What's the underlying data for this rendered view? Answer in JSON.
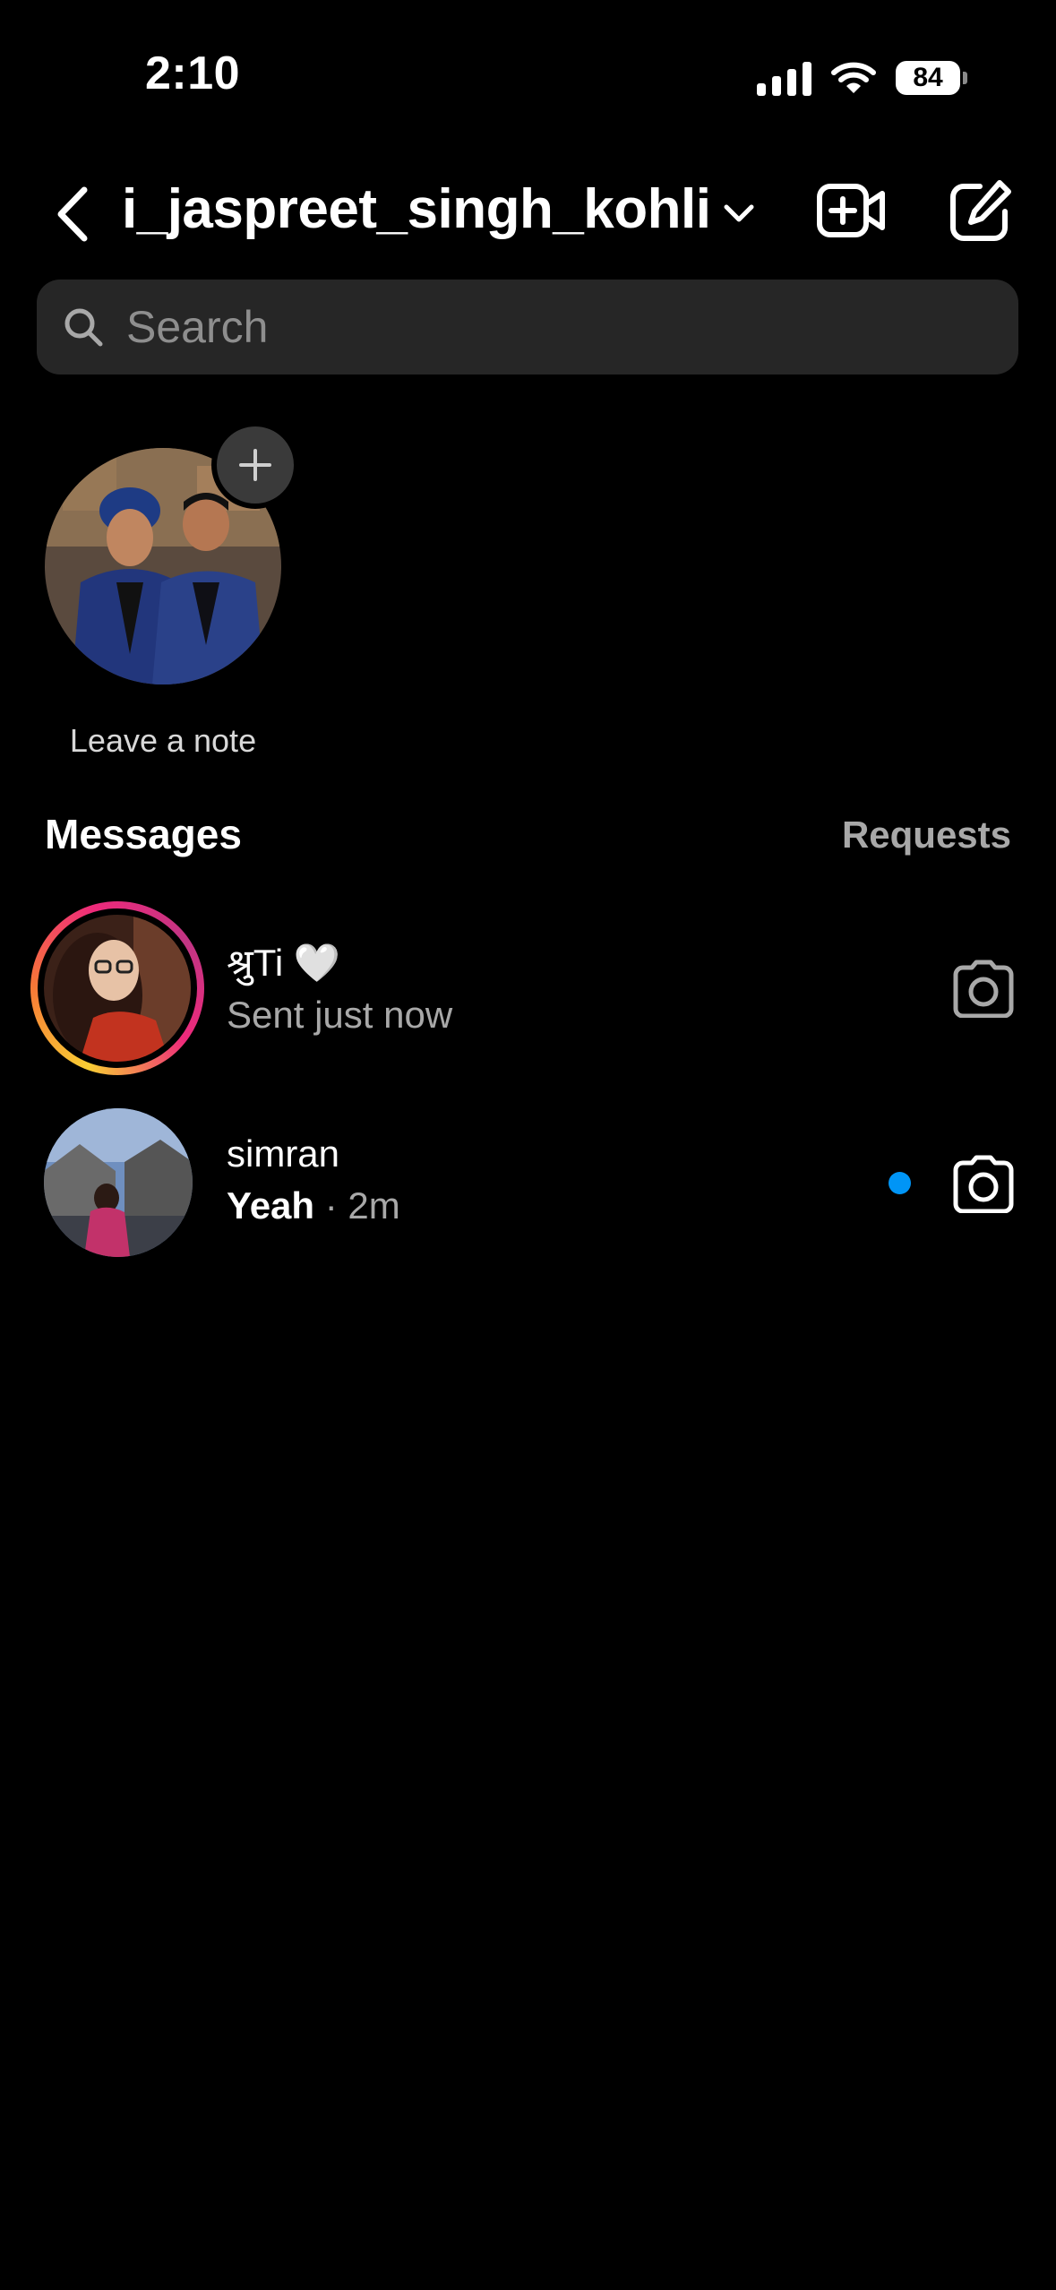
{
  "status_bar": {
    "time": "2:10",
    "battery": "84"
  },
  "header": {
    "title": "i_jaspreet_singh_kohli"
  },
  "search": {
    "placeholder": "Search"
  },
  "note": {
    "label": "Leave a note"
  },
  "messages": {
    "title": "Messages",
    "requests_label": "Requests",
    "threads": [
      {
        "name": "श्रुTi 🤍",
        "subtitle": "Sent just now",
        "unread": false,
        "has_story": true
      },
      {
        "name": "simran",
        "last_message": "Yeah",
        "time": "· 2m",
        "unread": true,
        "has_story": false
      }
    ]
  },
  "colors": {
    "unread_dot": "#0095f6",
    "search_bg": "#262626",
    "secondary_text": "#a8a8a8"
  },
  "icons": [
    "back-chevron-icon",
    "chevron-down-icon",
    "video-call-icon",
    "compose-icon",
    "search-icon",
    "plus-icon",
    "camera-icon"
  ]
}
